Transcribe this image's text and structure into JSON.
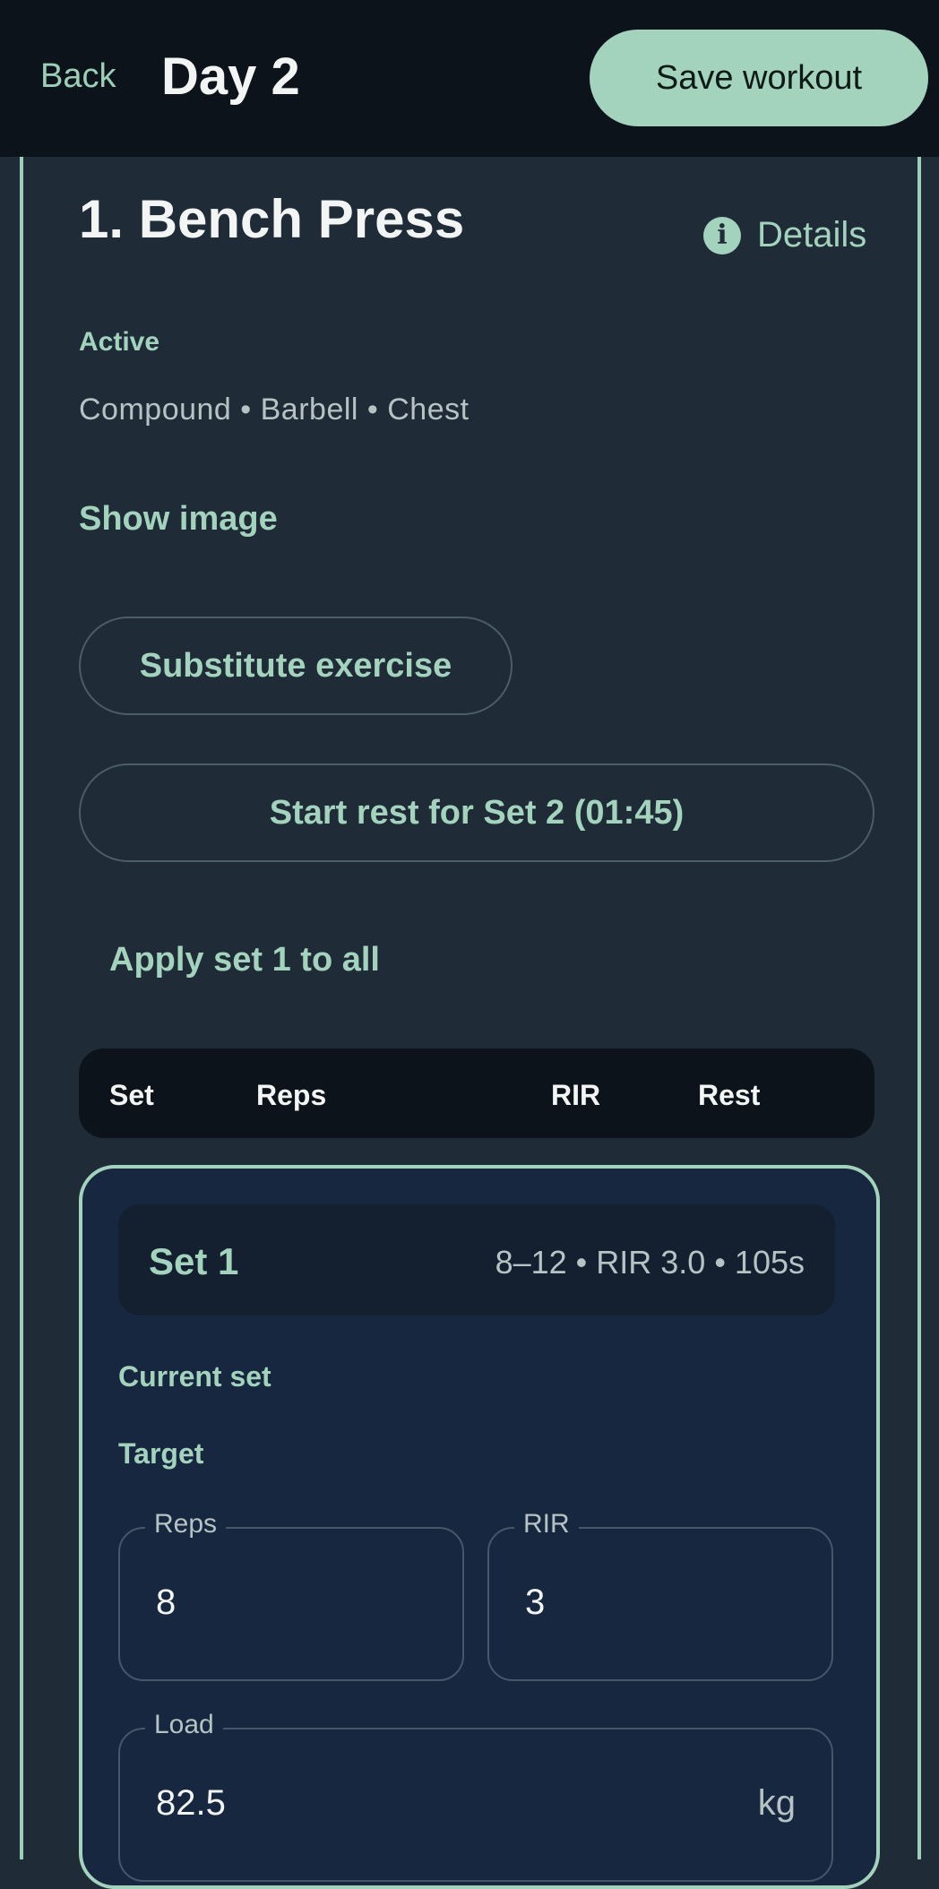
{
  "header": {
    "back_label": "Back",
    "title": "Day 2",
    "save_label": "Save workout"
  },
  "exercise": {
    "title": "1. Bench Press",
    "details_label": "Details",
    "status": "Active",
    "meta": "Compound • Barbell • Chest",
    "show_image_label": "Show image",
    "substitute_label": "Substitute exercise",
    "rest_button_label": "Start rest for Set 2 (01:45)",
    "apply_label": "Apply set 1 to all"
  },
  "table_header": {
    "columns": [
      "Set",
      "Reps",
      "RIR",
      "Rest"
    ]
  },
  "set": {
    "name": "Set 1",
    "summary": "8–12 • RIR 3.0 • 105s",
    "current_label": "Current set",
    "target_label": "Target",
    "fields": {
      "reps": {
        "label": "Reps",
        "value": "8"
      },
      "rir": {
        "label": "RIR",
        "value": "3"
      },
      "load": {
        "label": "Load",
        "value": "82.5",
        "unit": "kg"
      }
    }
  },
  "colors": {
    "accent": "#a3d3bd",
    "topbar": "#0d131a",
    "background": "#1f2b36",
    "set_card": "#16273f"
  }
}
